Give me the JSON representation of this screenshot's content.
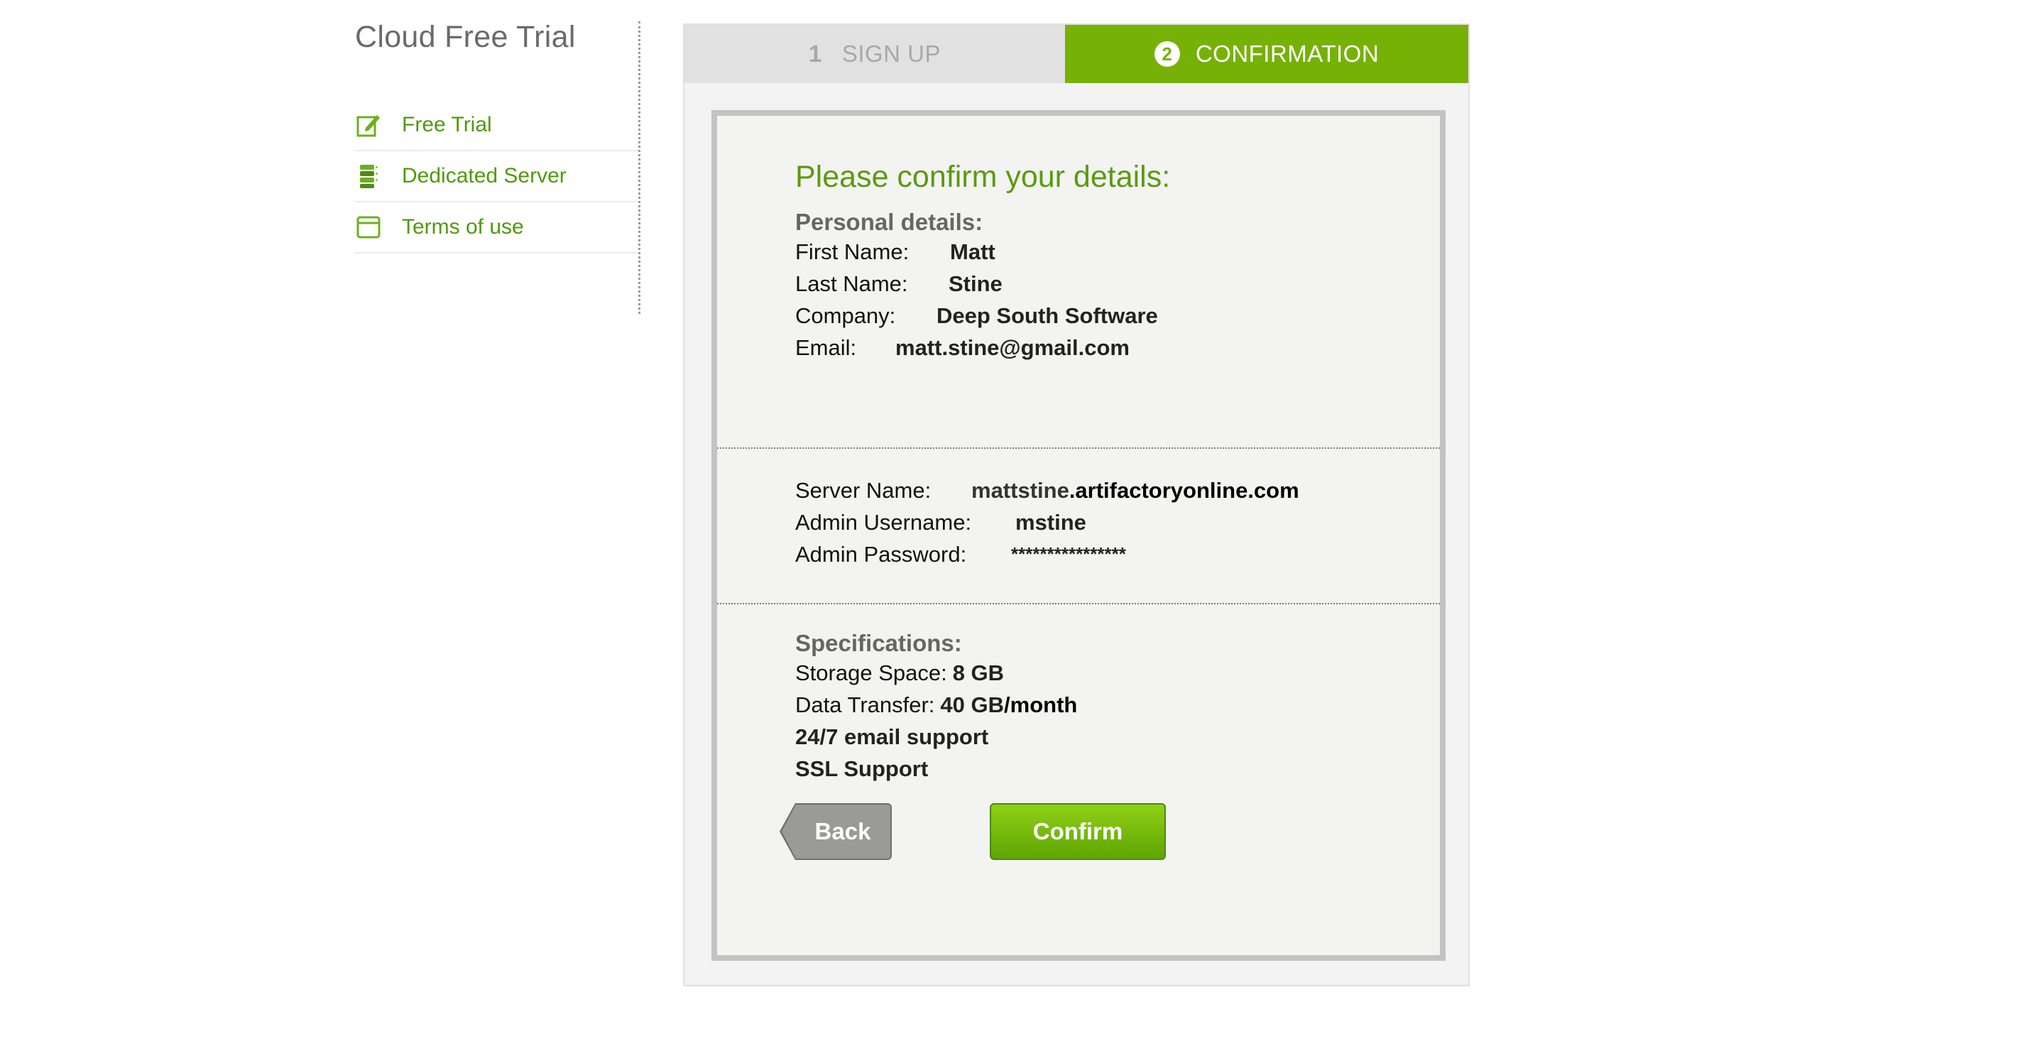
{
  "sidebar": {
    "title": "Cloud Free Trial",
    "items": [
      {
        "label": "Free Trial",
        "icon": "edit-icon"
      },
      {
        "label": "Dedicated Server",
        "icon": "server-icon"
      },
      {
        "label": "Terms of use",
        "icon": "document-icon"
      }
    ]
  },
  "wizard": {
    "steps": [
      {
        "number": "1",
        "label": "SIGN UP"
      },
      {
        "number": "2",
        "label": "CONFIRMATION"
      }
    ],
    "active_step": 2,
    "heading": "Please confirm your details:",
    "personal": {
      "title": "Personal details:",
      "rows": [
        {
          "key": "First Name:",
          "value": "Matt"
        },
        {
          "key": "Last Name:",
          "value": "Stine"
        },
        {
          "key": "Company:",
          "value": "Deep South Software"
        },
        {
          "key": "Email:",
          "value": "matt.stine@gmail.com"
        }
      ]
    },
    "server": {
      "rows": [
        {
          "key": "Server Name:",
          "value_prefix": "mattstine",
          "value_suffix": ".artifactoryonline.com"
        },
        {
          "key": "Admin Username:",
          "value": "mstine"
        },
        {
          "key": "Admin Password:",
          "value": "****************"
        }
      ]
    },
    "specs": {
      "title": "Specifications:",
      "storage_label": "Storage Space:",
      "storage_value": "8 GB",
      "transfer_label": "Data Transfer:",
      "transfer_value": "40 GB",
      "transfer_unit": "/month",
      "support": "24/7 email support",
      "ssl": "SSL Support"
    },
    "back_label": "Back",
    "confirm_label": "Confirm"
  },
  "colors": {
    "accent": "#76b106",
    "link": "#4f9a0a",
    "heading": "#5b9a10"
  }
}
